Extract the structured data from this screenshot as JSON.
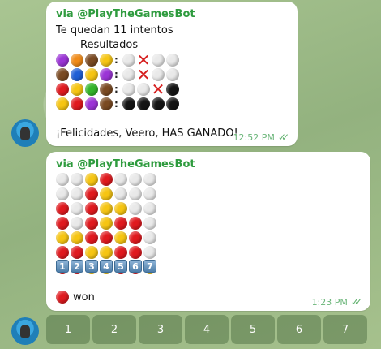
{
  "colors": {
    "purple": "#9b34d6",
    "orange": "#ef8a18",
    "brown": "#7a4a22",
    "yellow": "#f6c512",
    "blue": "#1f5fd6",
    "red": "#e0191e",
    "green": "#33b52a",
    "white": "#e9e9e9",
    "black": "#151515",
    "via": "#2e9b3e",
    "time": "#6bb67a"
  },
  "message1": {
    "via": "via @PlayTheGamesBot",
    "line1": "Te quedan 11 intentos",
    "line2": "Resultados",
    "rows": [
      {
        "guess": [
          "purple",
          "orange",
          "brown",
          "yellow"
        ],
        "result": [
          "white",
          "cross",
          "white",
          "white"
        ]
      },
      {
        "guess": [
          "brown",
          "blue",
          "yellow",
          "purple"
        ],
        "result": [
          "white",
          "cross",
          "white",
          "white"
        ]
      },
      {
        "guess": [
          "red",
          "yellow",
          "green",
          "brown"
        ],
        "result": [
          "white",
          "white",
          "cross",
          "black"
        ]
      },
      {
        "guess": [
          "yellow",
          "red",
          "purple",
          "brown"
        ],
        "result": [
          "black",
          "black",
          "black",
          "black"
        ]
      }
    ],
    "colon": ":",
    "line3": "¡Felicidades, Veero, HAS GANADO!",
    "time": "12:52 PM",
    "ticks": "✓✓"
  },
  "message2": {
    "via": "via @PlayTheGamesBot",
    "board": [
      [
        "white",
        "white",
        "yellow",
        "red",
        "white",
        "white",
        "white"
      ],
      [
        "white",
        "white",
        "red",
        "yellow",
        "white",
        "white",
        "white"
      ],
      [
        "red",
        "white",
        "red",
        "yellow",
        "yellow",
        "white",
        "white"
      ],
      [
        "red",
        "white",
        "red",
        "yellow",
        "red",
        "red",
        "white"
      ],
      [
        "yellow",
        "yellow",
        "red",
        "red",
        "yellow",
        "red",
        "white"
      ],
      [
        "red",
        "red",
        "yellow",
        "yellow",
        "red",
        "red",
        "white"
      ],
      [
        "red",
        "red",
        "yellow",
        "yellow",
        "red",
        "red",
        "yellow"
      ]
    ],
    "numbers": [
      "1",
      "2",
      "3",
      "4",
      "5",
      "6",
      "7"
    ],
    "winner_color": "red",
    "winner_text": "won",
    "time": "1:23 PM",
    "ticks": "✓✓"
  },
  "keyboard": [
    "1",
    "2",
    "3",
    "4",
    "5",
    "6",
    "7"
  ]
}
